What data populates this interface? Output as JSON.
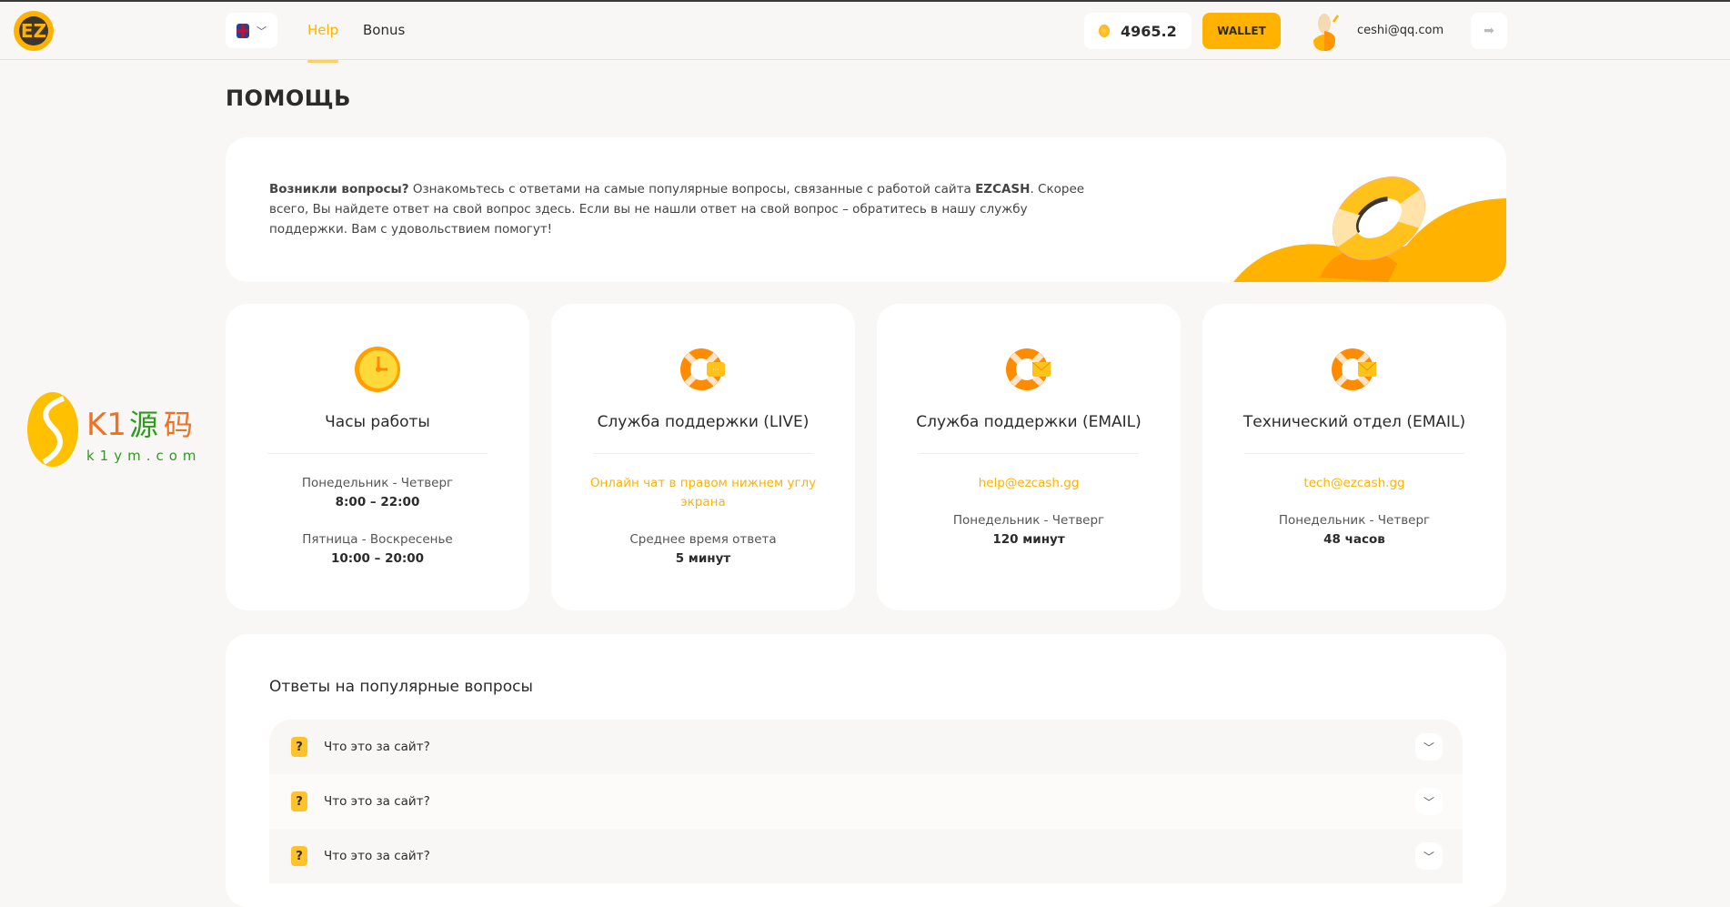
{
  "header": {
    "logo": "EZ",
    "language": "EN",
    "nav": [
      {
        "label": "Help",
        "active": true
      },
      {
        "label": "Bonus",
        "active": false
      }
    ],
    "balance": "4965.2",
    "wallet_label": "WALLET",
    "user_email": "ceshi@qq.com"
  },
  "page_title": "ПОМОЩЬ",
  "intro": {
    "bold_lead": "Возникли вопросы?",
    "text1": " Ознакомьтесь с ответами на самые популярные вопросы, связанные с работой сайта ",
    "brand": "EZCASH",
    "text2": ". Скорее всего, Вы найдете ответ на свой вопрос здесь. Если вы не нашли ответ на свой вопрос – обратитесь в нашу службу поддержки. Вам с удовольствием помогут!"
  },
  "cards": [
    {
      "title": "Часы работы",
      "icon": "clock-icon",
      "lines": [
        {
          "label": "Понедельник - Четверг",
          "value": "8:00 – 22:00"
        },
        {
          "label": "Пятница - Воскресенье",
          "value": "10:00 – 20:00"
        }
      ]
    },
    {
      "title": "Служба поддержки (LIVE)",
      "icon": "lifebuoy-chat-icon",
      "link": "Онлайн чат в правом нижнем углу экрана",
      "label": "Среднее время ответа",
      "value": "5 минут"
    },
    {
      "title": "Служба поддержки (EMAIL)",
      "icon": "lifebuoy-mail-icon",
      "link": "help@ezcash.gg",
      "label": "Понедельник - Четверг",
      "value": "120 минут"
    },
    {
      "title": "Технический отдел (EMAIL)",
      "icon": "lifebuoy-mail-icon",
      "link": "tech@ezcash.gg",
      "label": "Понедельник - Четверг",
      "value": "48 часов"
    }
  ],
  "faq": {
    "heading": "Ответы на популярные вопросы",
    "items": [
      "Что это за сайт?",
      "Что это за сайт?",
      "Что это за сайт?"
    ]
  },
  "watermark": {
    "text": "K1源码",
    "url": "k1ym.com"
  },
  "colors": {
    "accent": "#ffb300",
    "background": "#f8f7f5"
  }
}
